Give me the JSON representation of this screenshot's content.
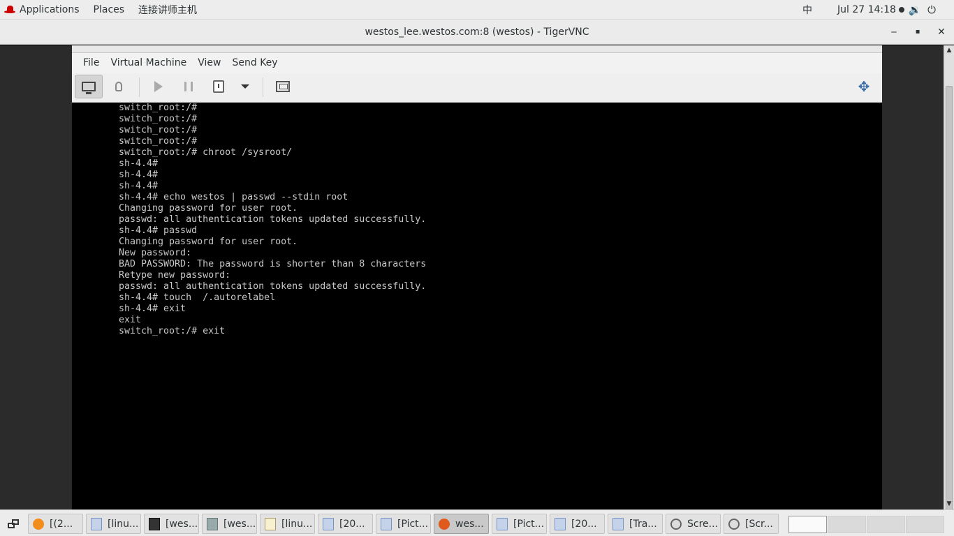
{
  "topbar": {
    "applications": "Applications",
    "places": "Places",
    "active_app": "连接讲师主机",
    "ime": "中",
    "clock": "Jul 27  14:18",
    "icons": [
      "volume-icon",
      "power-icon"
    ]
  },
  "window": {
    "title": "westos_lee.westos.com:8 (westos) - TigerVNC",
    "minimize": "‒",
    "maximize": "▪",
    "close": "✕"
  },
  "vm": {
    "menu": [
      "File",
      "Virtual Machine",
      "View",
      "Send Key"
    ]
  },
  "console_lines": [
    "switch_root:/#",
    "switch_root:/#",
    "switch_root:/#",
    "switch_root:/#",
    "switch_root:/# chroot /sysroot/",
    "sh-4.4#",
    "sh-4.4#",
    "sh-4.4#",
    "sh-4.4# echo westos | passwd --stdin root",
    "Changing password for user root.",
    "passwd: all authentication tokens updated successfully.",
    "sh-4.4# passwd",
    "Changing password for user root.",
    "New password:",
    "BAD PASSWORD: The password is shorter than 8 characters",
    "Retype new password:",
    "passwd: all authentication tokens updated successfully.",
    "sh-4.4# touch  /.autorelabel",
    "sh-4.4# exit",
    "exit",
    "switch_root:/# exit"
  ],
  "taskbar": {
    "tasks": [
      {
        "label": "[(2...",
        "icon": "firefox-icon"
      },
      {
        "label": "[linu...",
        "icon": "document-icon"
      },
      {
        "label": "[wes...",
        "icon": "terminal-icon"
      },
      {
        "label": "[wes...",
        "icon": "files-icon"
      },
      {
        "label": "[linu...",
        "icon": "text-editor-icon"
      },
      {
        "label": "[20...",
        "icon": "document-icon"
      },
      {
        "label": "[Pict...",
        "icon": "document-icon"
      },
      {
        "label": "wes...",
        "icon": "tigervnc-icon"
      },
      {
        "label": "[Pict...",
        "icon": "document-icon"
      },
      {
        "label": "[20...",
        "icon": "document-icon"
      },
      {
        "label": "[Tra...",
        "icon": "document-icon"
      },
      {
        "label": "Scre...",
        "icon": "screenshot-icon"
      },
      {
        "label": "[Scr...",
        "icon": "screenshot-icon"
      }
    ],
    "active_task": "wes...",
    "workspaces": 4
  }
}
